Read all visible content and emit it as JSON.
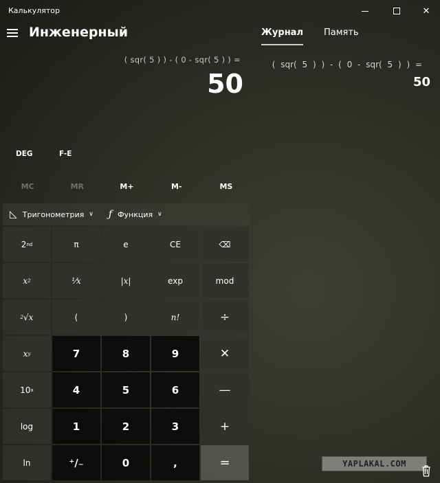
{
  "window": {
    "title": "Калькулятор"
  },
  "header": {
    "mode_title": "Инженерный"
  },
  "display": {
    "expression": "( sqr( 5 ) ) - ( 0 - sqr( 5 ) ) =",
    "result": "50"
  },
  "tabs": [
    {
      "label": "Журнал",
      "active": true
    },
    {
      "label": "Память",
      "active": false
    }
  ],
  "history": {
    "expression": "( sqr( 5 ) ) - ( 0 - sqr( 5 ) ) =",
    "result": "50"
  },
  "modes": {
    "angle": "DEG",
    "fe": "F-E"
  },
  "memory": [
    "MC",
    "MR",
    "M+",
    "M-",
    "MS"
  ],
  "function_bar": {
    "trig": "Тригонометрия",
    "func": "Функция"
  },
  "keys": {
    "r1": [
      "π",
      "e",
      "CE"
    ],
    "r2_mid": [
      "exp",
      "mod"
    ],
    "r3": [
      "(",
      ")"
    ],
    "nums": [
      "7",
      "8",
      "9",
      "4",
      "5",
      "6",
      "1",
      "2",
      "3",
      "0"
    ],
    "log": "log",
    "ln": "ln",
    "comma": ",",
    "plusminus": "⁺∕₋"
  },
  "watermark": "YAPLAKAL.COM"
}
